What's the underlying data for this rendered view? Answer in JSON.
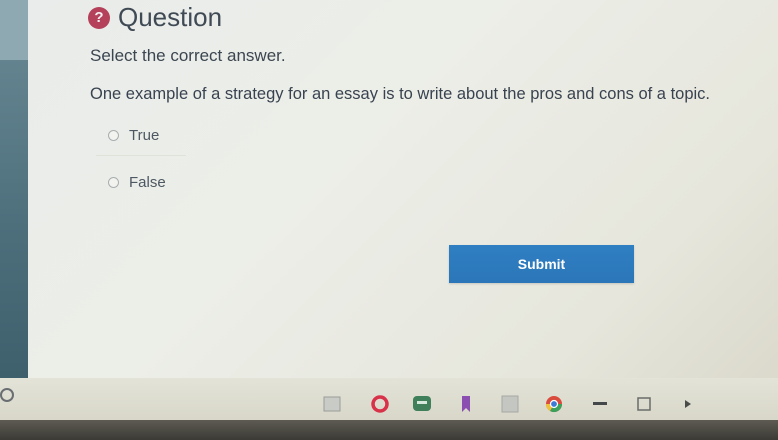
{
  "question": {
    "icon": "question-circle-icon",
    "title": "Question",
    "instruction": "Select the correct answer.",
    "text": "One example of a strategy for an essay is to write about the pros and cons of a topic.",
    "options": [
      {
        "label": "True"
      },
      {
        "label": "False"
      }
    ],
    "submit_label": "Submit"
  },
  "colors": {
    "accent": "#2f7fc3",
    "question_icon": "#b4405a",
    "left_bar": "#4d6f7c"
  },
  "taskbar": {
    "icons": [
      "start-icon",
      "window-icon",
      "red-ring-app-icon",
      "chat-app-icon",
      "bookmark-icon",
      "gray-app-icon",
      "chrome-icon",
      "minus-icon",
      "square-icon",
      "play-icon"
    ]
  }
}
